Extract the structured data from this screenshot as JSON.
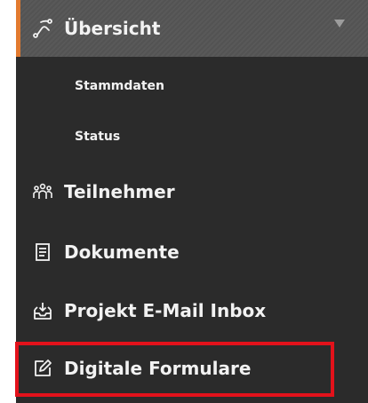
{
  "nav": {
    "active": {
      "label": "Übersicht",
      "icon": "route-icon"
    },
    "subitems": [
      {
        "label": "Stammdaten"
      },
      {
        "label": "Status"
      }
    ],
    "items": [
      {
        "label": "Teilnehmer",
        "icon": "users-group-icon"
      },
      {
        "label": "Dokumente",
        "icon": "document-icon"
      },
      {
        "label": "Projekt E-Mail Inbox",
        "icon": "inbox-icon"
      },
      {
        "label": "Digitale Formulare",
        "icon": "edit-form-icon"
      }
    ]
  },
  "colors": {
    "sidebar_bg": "#2b2b2b",
    "active_bg": "#555555",
    "active_accent": "#e27a2f",
    "text": "#f2f2f2",
    "highlight": "#e3121b"
  }
}
